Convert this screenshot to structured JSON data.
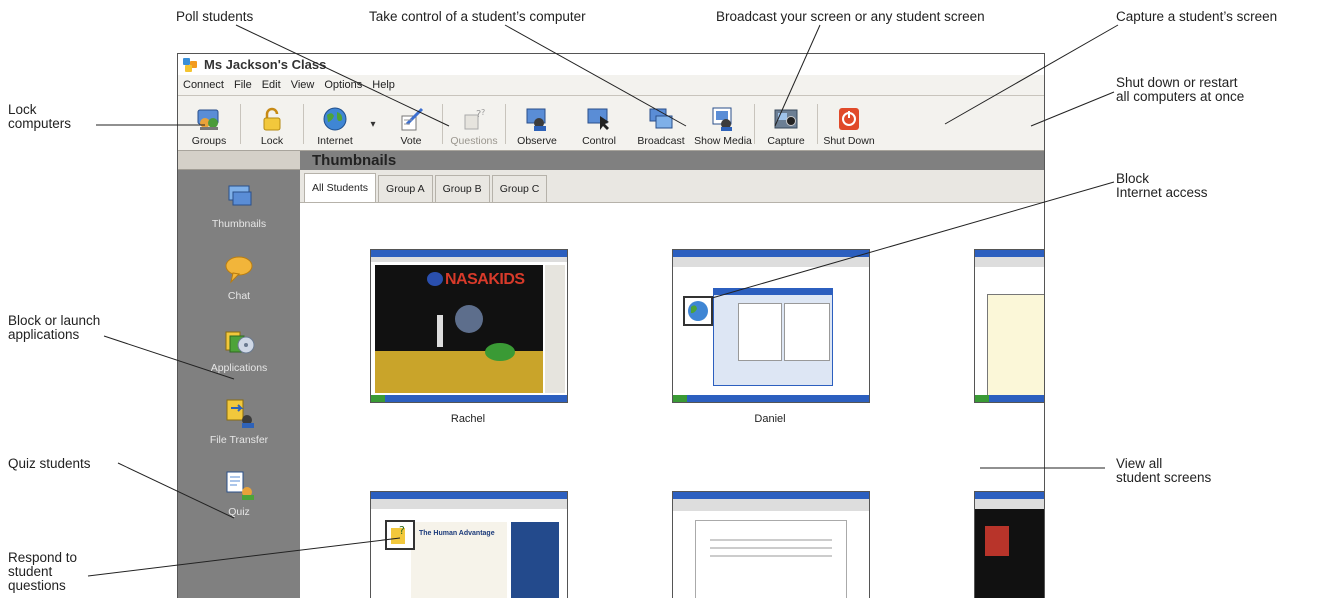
{
  "callouts": {
    "poll": "Poll students",
    "control": "Take control of a student’s computer",
    "broadcast": "Broadcast your screen or any student screen",
    "capture": "Capture a student’s screen",
    "lock_1": "Lock",
    "lock_2": "computers",
    "shutdown_1": "Shut down or restart",
    "shutdown_2": "all computers at once",
    "block_apps_1": "Block or launch",
    "block_apps_2": "applications",
    "block_internet_1": "Block",
    "block_internet_2": "Internet access",
    "quiz": "Quiz students",
    "view_all_1": "View all",
    "view_all_2": "student screens",
    "respond_1": "Respond to",
    "respond_2": "student",
    "respond_3": "questions"
  },
  "app": {
    "title": "Ms Jackson's Class",
    "menu": [
      "Connect",
      "File",
      "Edit",
      "View",
      "Options",
      "Help"
    ],
    "toolbar": {
      "groups": "Groups",
      "lock": "Lock",
      "internet": "Internet",
      "dropdown": "▾",
      "vote": "Vote",
      "questions": "Questions",
      "observe": "Observe",
      "control": "Control",
      "broadcast": "Broadcast",
      "show_media": "Show Media",
      "capture": "Capture",
      "shut_down": "Shut Down"
    },
    "sidebar": [
      "Thumbnails",
      "Chat",
      "Applications",
      "File Transfer",
      "Quiz"
    ],
    "panel_title": "Thumbnails",
    "tabs": [
      "All Students",
      "Group A",
      "Group B",
      "Group C"
    ],
    "thumbnails": [
      {
        "name": "Rachel",
        "screen_text": "NASAKIDS"
      },
      {
        "name": "Daniel",
        "screen_text": ""
      },
      {
        "name": "",
        "screen_text": ""
      },
      {
        "name": "",
        "screen_text": "The Human Advantage"
      },
      {
        "name": "",
        "screen_text": ""
      },
      {
        "name": "",
        "screen_text": ""
      }
    ]
  },
  "colors": {
    "sidebar_bg": "#808080",
    "title_blue": "#2c5fbf",
    "shutdown_red": "#e04a2a"
  }
}
